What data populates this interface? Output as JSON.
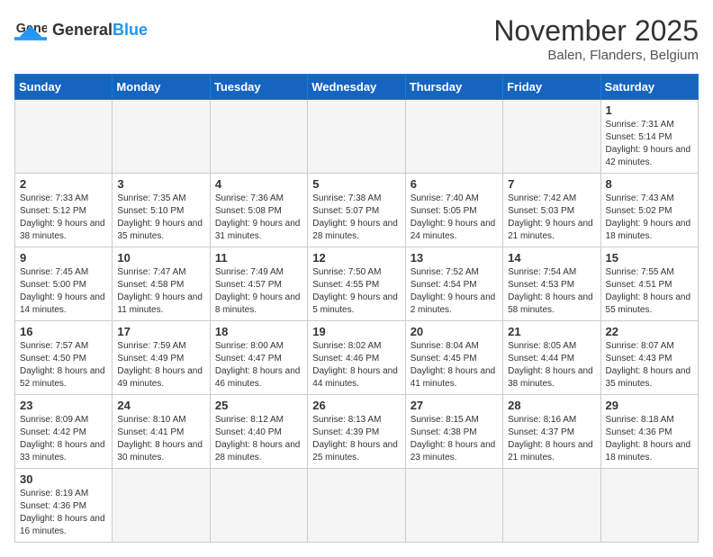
{
  "header": {
    "logo_general": "General",
    "logo_blue": "Blue",
    "month_title": "November 2025",
    "location": "Balen, Flanders, Belgium"
  },
  "days_of_week": [
    "Sunday",
    "Monday",
    "Tuesday",
    "Wednesday",
    "Thursday",
    "Friday",
    "Saturday"
  ],
  "weeks": [
    [
      {
        "day": "",
        "info": ""
      },
      {
        "day": "",
        "info": ""
      },
      {
        "day": "",
        "info": ""
      },
      {
        "day": "",
        "info": ""
      },
      {
        "day": "",
        "info": ""
      },
      {
        "day": "",
        "info": ""
      },
      {
        "day": "1",
        "info": "Sunrise: 7:31 AM\nSunset: 5:14 PM\nDaylight: 9 hours and 42 minutes."
      }
    ],
    [
      {
        "day": "2",
        "info": "Sunrise: 7:33 AM\nSunset: 5:12 PM\nDaylight: 9 hours and 38 minutes."
      },
      {
        "day": "3",
        "info": "Sunrise: 7:35 AM\nSunset: 5:10 PM\nDaylight: 9 hours and 35 minutes."
      },
      {
        "day": "4",
        "info": "Sunrise: 7:36 AM\nSunset: 5:08 PM\nDaylight: 9 hours and 31 minutes."
      },
      {
        "day": "5",
        "info": "Sunrise: 7:38 AM\nSunset: 5:07 PM\nDaylight: 9 hours and 28 minutes."
      },
      {
        "day": "6",
        "info": "Sunrise: 7:40 AM\nSunset: 5:05 PM\nDaylight: 9 hours and 24 minutes."
      },
      {
        "day": "7",
        "info": "Sunrise: 7:42 AM\nSunset: 5:03 PM\nDaylight: 9 hours and 21 minutes."
      },
      {
        "day": "8",
        "info": "Sunrise: 7:43 AM\nSunset: 5:02 PM\nDaylight: 9 hours and 18 minutes."
      }
    ],
    [
      {
        "day": "9",
        "info": "Sunrise: 7:45 AM\nSunset: 5:00 PM\nDaylight: 9 hours and 14 minutes."
      },
      {
        "day": "10",
        "info": "Sunrise: 7:47 AM\nSunset: 4:58 PM\nDaylight: 9 hours and 11 minutes."
      },
      {
        "day": "11",
        "info": "Sunrise: 7:49 AM\nSunset: 4:57 PM\nDaylight: 9 hours and 8 minutes."
      },
      {
        "day": "12",
        "info": "Sunrise: 7:50 AM\nSunset: 4:55 PM\nDaylight: 9 hours and 5 minutes."
      },
      {
        "day": "13",
        "info": "Sunrise: 7:52 AM\nSunset: 4:54 PM\nDaylight: 9 hours and 2 minutes."
      },
      {
        "day": "14",
        "info": "Sunrise: 7:54 AM\nSunset: 4:53 PM\nDaylight: 8 hours and 58 minutes."
      },
      {
        "day": "15",
        "info": "Sunrise: 7:55 AM\nSunset: 4:51 PM\nDaylight: 8 hours and 55 minutes."
      }
    ],
    [
      {
        "day": "16",
        "info": "Sunrise: 7:57 AM\nSunset: 4:50 PM\nDaylight: 8 hours and 52 minutes."
      },
      {
        "day": "17",
        "info": "Sunrise: 7:59 AM\nSunset: 4:49 PM\nDaylight: 8 hours and 49 minutes."
      },
      {
        "day": "18",
        "info": "Sunrise: 8:00 AM\nSunset: 4:47 PM\nDaylight: 8 hours and 46 minutes."
      },
      {
        "day": "19",
        "info": "Sunrise: 8:02 AM\nSunset: 4:46 PM\nDaylight: 8 hours and 44 minutes."
      },
      {
        "day": "20",
        "info": "Sunrise: 8:04 AM\nSunset: 4:45 PM\nDaylight: 8 hours and 41 minutes."
      },
      {
        "day": "21",
        "info": "Sunrise: 8:05 AM\nSunset: 4:44 PM\nDaylight: 8 hours and 38 minutes."
      },
      {
        "day": "22",
        "info": "Sunrise: 8:07 AM\nSunset: 4:43 PM\nDaylight: 8 hours and 35 minutes."
      }
    ],
    [
      {
        "day": "23",
        "info": "Sunrise: 8:09 AM\nSunset: 4:42 PM\nDaylight: 8 hours and 33 minutes."
      },
      {
        "day": "24",
        "info": "Sunrise: 8:10 AM\nSunset: 4:41 PM\nDaylight: 8 hours and 30 minutes."
      },
      {
        "day": "25",
        "info": "Sunrise: 8:12 AM\nSunset: 4:40 PM\nDaylight: 8 hours and 28 minutes."
      },
      {
        "day": "26",
        "info": "Sunrise: 8:13 AM\nSunset: 4:39 PM\nDaylight: 8 hours and 25 minutes."
      },
      {
        "day": "27",
        "info": "Sunrise: 8:15 AM\nSunset: 4:38 PM\nDaylight: 8 hours and 23 minutes."
      },
      {
        "day": "28",
        "info": "Sunrise: 8:16 AM\nSunset: 4:37 PM\nDaylight: 8 hours and 21 minutes."
      },
      {
        "day": "29",
        "info": "Sunrise: 8:18 AM\nSunset: 4:36 PM\nDaylight: 8 hours and 18 minutes."
      }
    ],
    [
      {
        "day": "30",
        "info": "Sunrise: 8:19 AM\nSunset: 4:36 PM\nDaylight: 8 hours and 16 minutes."
      },
      {
        "day": "",
        "info": ""
      },
      {
        "day": "",
        "info": ""
      },
      {
        "day": "",
        "info": ""
      },
      {
        "day": "",
        "info": ""
      },
      {
        "day": "",
        "info": ""
      },
      {
        "day": "",
        "info": ""
      }
    ]
  ]
}
